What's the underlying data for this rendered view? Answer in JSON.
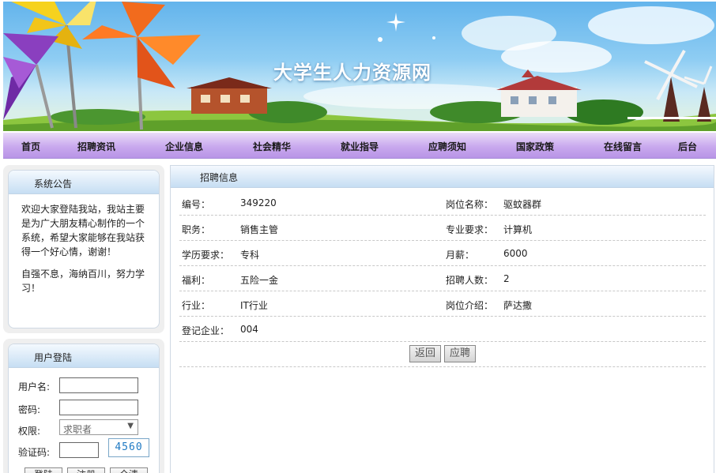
{
  "site": {
    "title": "大学生人力资源网"
  },
  "nav": [
    {
      "label": "首页"
    },
    {
      "label": "招聘资讯"
    },
    {
      "label": "企业信息"
    },
    {
      "label": "社会精华"
    },
    {
      "label": "就业指导"
    },
    {
      "label": "应聘须知"
    },
    {
      "label": "国家政策"
    },
    {
      "label": "在线留言"
    },
    {
      "label": "后台"
    }
  ],
  "announcement": {
    "title": "系统公告",
    "paragraphs": [
      "欢迎大家登陆我站，我站主要是为广大朋友精心制作的一个系统，希望大家能够在我站获得一个好心情，谢谢！",
      "自强不息，海纳百川，努力学习！"
    ]
  },
  "login": {
    "title": "用户登陆",
    "username_label": "用户名:",
    "password_label": "密码:",
    "role_label": "权限:",
    "role_value": "求职者",
    "captcha_label": "验证码:",
    "captcha_value": "4560",
    "buttons": [
      "登陆",
      "注册",
      "全清"
    ]
  },
  "job": {
    "title": "招聘信息",
    "rows": [
      {
        "left_label": "编号：",
        "left_value": "349220",
        "right_label": "岗位名称：",
        "right_value": "驱蚊器群"
      },
      {
        "left_label": "职务：",
        "left_value": "销售主管",
        "right_label": "专业要求：",
        "right_value": "计算机"
      },
      {
        "left_label": "学历要求：",
        "left_value": "专科",
        "right_label": "月薪：",
        "right_value": "6000"
      },
      {
        "left_label": "福利：",
        "left_value": "五险一金",
        "right_label": "招聘人数：",
        "right_value": "2"
      },
      {
        "left_label": "行业：",
        "left_value": "IT行业",
        "right_label": "岗位介绍：",
        "right_value": "萨达撒"
      },
      {
        "left_label": "登记企业：",
        "left_value": "004",
        "right_label": "",
        "right_value": ""
      }
    ],
    "back_label": "返回",
    "apply_label": "应聘"
  },
  "colors": {
    "nav": "#c9a9ee",
    "panel_header": "#c6def3",
    "sky": "#63b4ec"
  },
  "icons": [
    "pinwheel-icon",
    "windmill-icon",
    "house-icon",
    "sparkle-icon",
    "dropdown-arrow-icon"
  ]
}
